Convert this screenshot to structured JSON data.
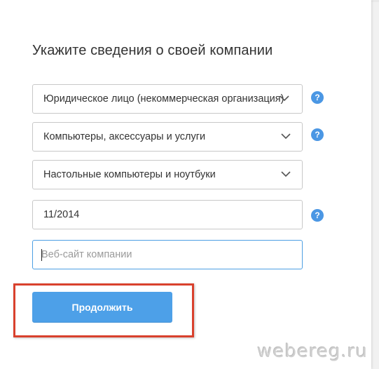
{
  "title": "Укажите сведения о своей компании",
  "fields": {
    "org_type": "Юридическое лицо (некоммерческая организация)",
    "industry": "Компьютеры, аксессуары и услуги",
    "subcategory": "Настольные компьютеры и ноутбуки",
    "date": "11/2014",
    "website_placeholder": "Веб-сайт компании",
    "website_value": ""
  },
  "help_glyph": "?",
  "button": {
    "label": "Продолжить"
  },
  "watermark": "webereg.ru",
  "colors": {
    "accent": "#4da0e8",
    "help_icon": "#4b97e4",
    "highlight": "#d9412d",
    "focus_border": "#4d9fe3"
  },
  "icons": [
    "chevron-down-icon",
    "help-icon"
  ]
}
